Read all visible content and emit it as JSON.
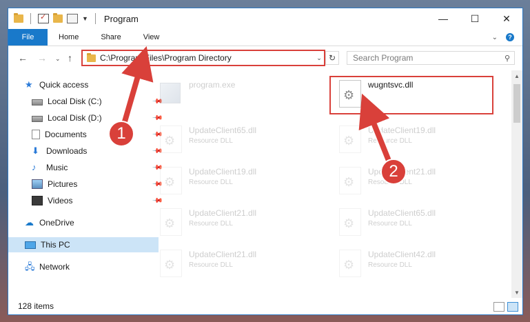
{
  "window": {
    "title": "Program",
    "controls": {
      "minimize": "—",
      "maximize": "☐",
      "close": "✕"
    }
  },
  "ribbon": {
    "tabs": [
      "File",
      "Home",
      "Share",
      "View"
    ],
    "expand_glyph": "⌄",
    "help_glyph": "?"
  },
  "address_bar": {
    "path": "C:\\Program Files\\Program Directory",
    "search_placeholder": "Search Program"
  },
  "sidebar": {
    "items": [
      {
        "label": "Quick access",
        "icon": "star-icon"
      },
      {
        "label": "Local Disk (C:)",
        "icon": "disk-icon",
        "pinned": true
      },
      {
        "label": "Local Disk (D:)",
        "icon": "disk-icon",
        "pinned": true
      },
      {
        "label": "Documents",
        "icon": "documents-icon",
        "pinned": true
      },
      {
        "label": "Downloads",
        "icon": "downloads-icon",
        "pinned": true
      },
      {
        "label": "Music",
        "icon": "music-icon",
        "pinned": true
      },
      {
        "label": "Pictures",
        "icon": "pictures-icon",
        "pinned": true
      },
      {
        "label": "Videos",
        "icon": "videos-icon",
        "pinned": true
      },
      {
        "label": "OneDrive",
        "icon": "onedrive-icon"
      },
      {
        "label": "This PC",
        "icon": "this-pc-icon",
        "selected": true
      },
      {
        "label": "Network",
        "icon": "network-icon"
      }
    ]
  },
  "files": [
    {
      "name": "program.exe",
      "type": ""
    },
    {
      "name": "wugntsvc.dll",
      "type": ""
    },
    {
      "name": "UpdateClient65.dll",
      "type": "Resource DLL"
    },
    {
      "name": "UpdateClient19.dll",
      "type": "Resource DLL"
    },
    {
      "name": "UpdateClient19.dll",
      "type": "Resource DLL"
    },
    {
      "name": "UpdateClient21.dll",
      "type": "Resource DLL"
    },
    {
      "name": "UpdateClient21.dll",
      "type": "Resource DLL"
    },
    {
      "name": "UpdateClient65.dll",
      "type": "Resource DLL"
    },
    {
      "name": "UpdateClient21.dll",
      "type": "Resource DLL"
    },
    {
      "name": "UpdateClient42.dll",
      "type": "Resource DLL"
    }
  ],
  "status": {
    "item_count": "128 items"
  },
  "annotations": {
    "step1": "1",
    "step2": "2"
  },
  "colors": {
    "accent": "#1979ca",
    "highlight": "#d9403a",
    "selection": "#cce4f7"
  }
}
